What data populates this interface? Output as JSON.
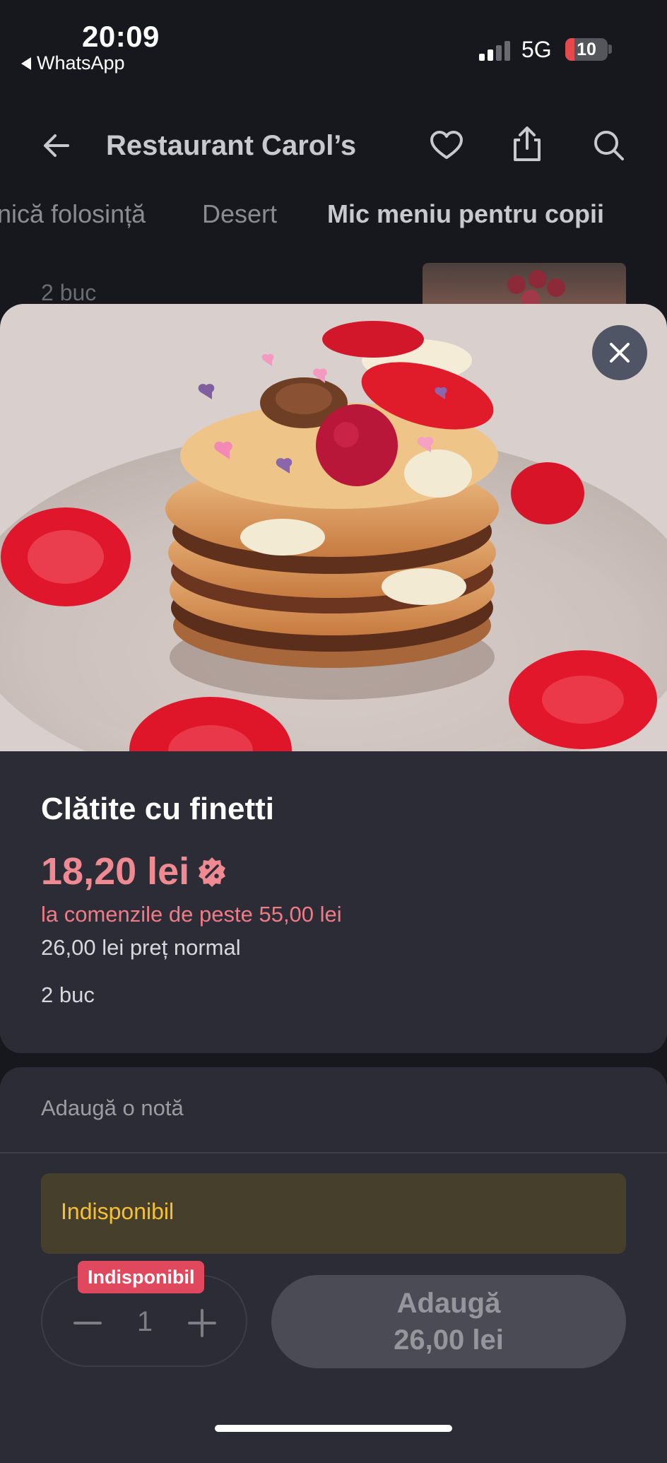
{
  "status_bar": {
    "time": "20:09",
    "back_app": "WhatsApp",
    "network": "5G",
    "battery": "10",
    "battery_level": 0.1
  },
  "header": {
    "title": "Restaurant Carol’s",
    "icons": [
      "back-arrow-icon",
      "heart-icon",
      "share-icon",
      "search-icon"
    ]
  },
  "tabs": [
    {
      "label": "nică folosință",
      "active": false
    },
    {
      "label": "Desert",
      "active": false
    },
    {
      "label": "Mic meniu pentru copii",
      "active": true
    }
  ],
  "background_list": {
    "item_qty": "2 buc"
  },
  "product": {
    "name": "Clătite cu finetti",
    "price": "18,20 lei",
    "price_icon": "discount-icon",
    "promo_text": "la comenzile de peste 55,00 lei",
    "normal_price": "26,00 lei preț normal",
    "quantity_text": "2 buc"
  },
  "note": {
    "label": "Adaugă o notă"
  },
  "availability": {
    "banner": "Indisponibil",
    "badge": "Indisponibil"
  },
  "stepper": {
    "value": "1"
  },
  "add_button": {
    "line1": "Adaugă",
    "line2": "26,00 lei"
  },
  "colors": {
    "background": "#17181d",
    "sheet": "#2b2c36",
    "price": "#f08a92",
    "warning_bg": "#463f2c",
    "warning_text": "#f7c032",
    "badge": "#e0485d"
  }
}
